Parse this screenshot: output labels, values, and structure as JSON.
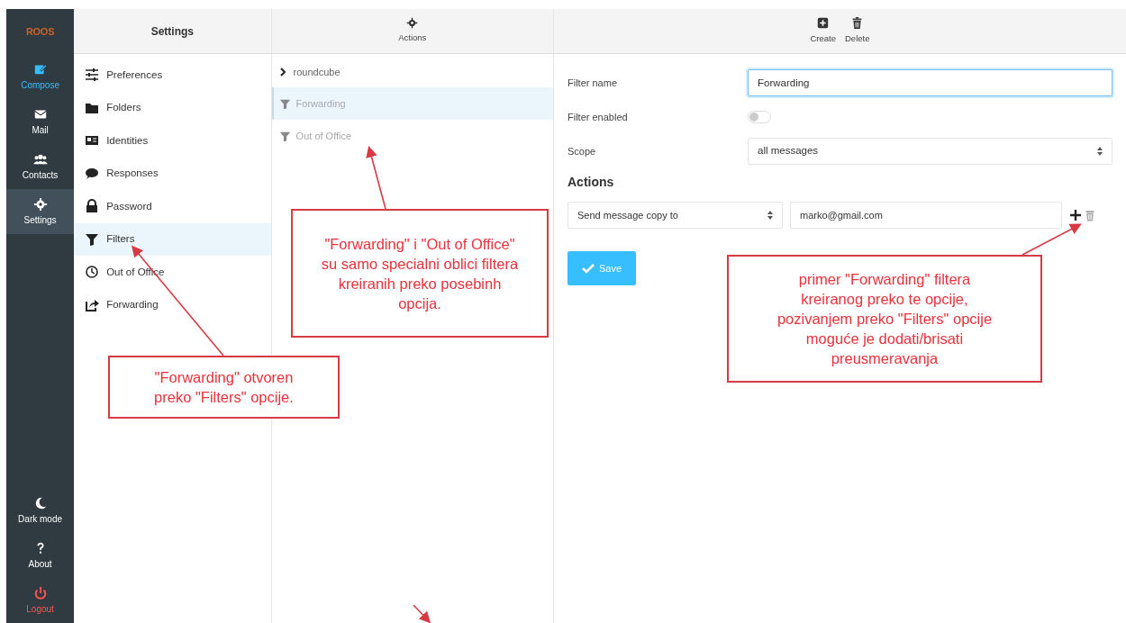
{
  "nav": {
    "logo": "ROOS",
    "items": [
      {
        "label": "Compose",
        "kind": "primary",
        "selected": false
      },
      {
        "label": "Mail",
        "kind": "normal",
        "selected": false
      },
      {
        "label": "Contacts",
        "kind": "normal",
        "selected": false
      },
      {
        "label": "Settings",
        "kind": "normal",
        "selected": true
      }
    ],
    "bottom": [
      {
        "label": "Dark mode",
        "kind": "normal"
      },
      {
        "label": "About",
        "kind": "normal"
      },
      {
        "label": "Logout",
        "kind": "danger"
      }
    ]
  },
  "settings": {
    "title": "Settings",
    "items": [
      {
        "label": "Preferences",
        "selected": false
      },
      {
        "label": "Folders",
        "selected": false
      },
      {
        "label": "Identities",
        "selected": false
      },
      {
        "label": "Responses",
        "selected": false
      },
      {
        "label": "Password",
        "selected": false
      },
      {
        "label": "Filters",
        "selected": true
      },
      {
        "label": "Out of Office",
        "selected": false
      },
      {
        "label": "Forwarding",
        "selected": false
      }
    ]
  },
  "filters": {
    "toolbar": [
      "Actions"
    ],
    "set": {
      "label": "roundcube",
      "expanded": false
    },
    "items": [
      {
        "label": "Forwarding",
        "selected": true,
        "enabled": false
      },
      {
        "label": "Out of Office",
        "selected": false,
        "enabled": false
      }
    ]
  },
  "editor": {
    "toolbar": [
      "Create",
      "Delete"
    ],
    "fields": [
      {
        "kind": "text",
        "label": "Filter name",
        "value": "Forwarding"
      },
      {
        "kind": "toggle",
        "label": "Filter enabled",
        "on": false
      },
      {
        "kind": "select",
        "label": "Scope",
        "value": "all messages"
      }
    ],
    "actions_title": "Actions",
    "action": {
      "type": "Send message copy to",
      "target": "marko@gmail.com"
    },
    "save": "Save"
  },
  "annotations": [
    {
      "text": "\"Forwarding\" otvoren preko \"Filters\" opcije."
    },
    {
      "text": "\"Forwarding\" i \"Out of Office\" su samo specialni oblici filtera kreiranih preko posebinh opcija."
    },
    {
      "text": "primer \"Forwarding\" filtera kreiranog preko te opcije, pozivanjem preko \"Filters\" opcije moguće je dodati/brisati preusmeravanja"
    }
  ]
}
